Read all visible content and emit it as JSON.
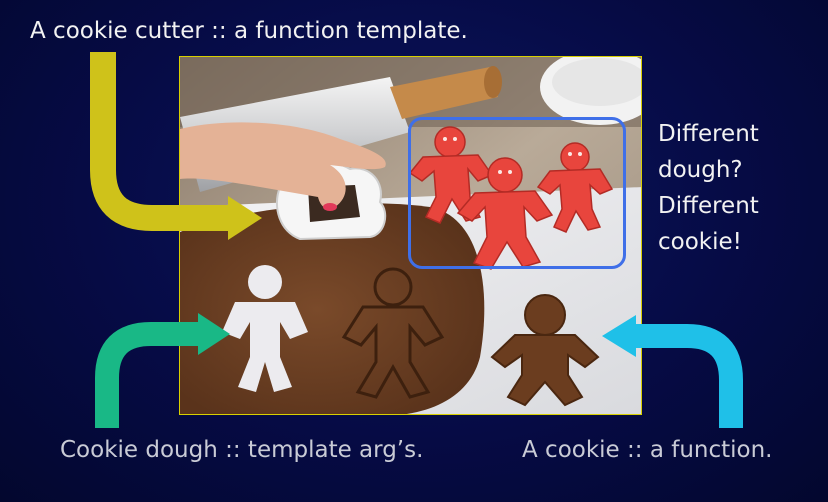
{
  "slide": {
    "title": "A cookie cutter :: a function template.",
    "side_note_lines": [
      "Different",
      "dough?",
      "Different",
      "cookie!"
    ],
    "label_left": "Cookie dough :: template arg’s.",
    "label_right": "A cookie :: a function."
  },
  "colors": {
    "background": "#050a3d",
    "photo_border": "#d8d000",
    "highlight_border": "#3f6fe8",
    "arrow_yellow": "#cfc21a",
    "arrow_green": "#19b886",
    "arrow_cyan": "#1fc0e8"
  },
  "icons": {
    "title_arrow": "yellow-curved-arrow-icon",
    "dough_arrow": "green-curved-arrow-icon",
    "cookie_arrow": "cyan-curved-arrow-icon"
  }
}
